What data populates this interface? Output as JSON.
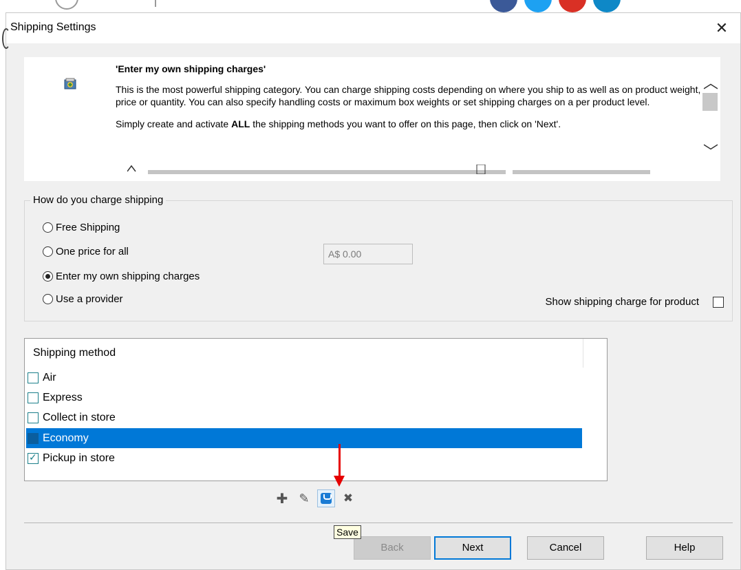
{
  "dialog": {
    "title": "Shipping Settings",
    "close_glyph": "✕"
  },
  "info": {
    "heading": "'Enter my own shipping charges'",
    "paragraph1": "This is the most powerful shipping category. You can charge shipping costs depending on where you ship to as well as on product weight, price or quantity. You can also specify handling costs or maximum box weights or set shipping charges on a per product level.",
    "paragraph2_before": "Simply create and activate ",
    "paragraph2_bold": "ALL",
    "paragraph2_after": " the shipping methods you want to offer  on this page, then click on 'Next'.",
    "scroll_up_glyph": "︿",
    "scroll_down_glyph": "﹀",
    "icon": "shipping-info-icon"
  },
  "charge_group": {
    "legend": "How do you charge shipping",
    "options": [
      {
        "label": "Free Shipping",
        "selected": false
      },
      {
        "label": "One price for all",
        "selected": false
      },
      {
        "label": "Enter my own shipping charges",
        "selected": true
      },
      {
        "label": "Use a provider",
        "selected": false
      }
    ],
    "price_value": "A$ 0.00",
    "show_charge_label": "Show shipping charge for product",
    "show_charge_checked": false
  },
  "method_list": {
    "header": "Shipping method",
    "items": [
      {
        "label": "Air",
        "checked": false,
        "selected": false
      },
      {
        "label": "Express",
        "checked": false,
        "selected": false
      },
      {
        "label": "Collect in store",
        "checked": false,
        "selected": false
      },
      {
        "label": "Economy",
        "checked": false,
        "selected": true
      },
      {
        "label": "Pickup in store",
        "checked": true,
        "selected": false
      }
    ]
  },
  "toolbar": {
    "add_glyph": "✚",
    "edit_glyph": "✎",
    "delete_glyph": "✖",
    "tooltip": "Save"
  },
  "buttons": {
    "back": "Back",
    "next": "Next",
    "cancel": "Cancel",
    "help": "Help"
  },
  "colors": {
    "selection": "#0078d7",
    "arrow": "#e60000",
    "checkbox_border": "#1b7f8a"
  }
}
